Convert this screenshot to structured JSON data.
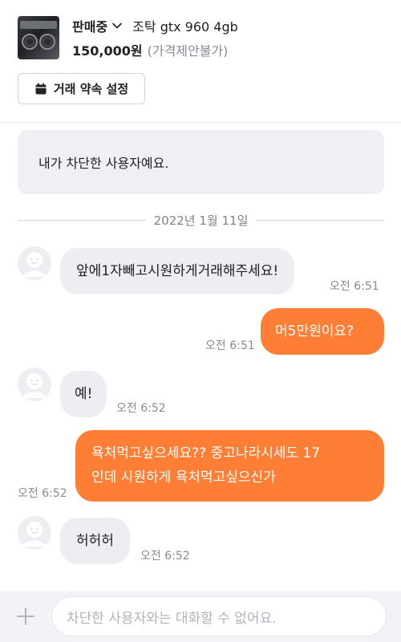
{
  "header": {
    "thumbnail_icon": "graphics-card-photo",
    "status_label": "판매중",
    "status_chevron_icon": "chevron-down-icon",
    "product_title": "조탁 gtx 960 4gb",
    "price": "150,000원",
    "price_note": "(가격제안불가)",
    "appointment_button": {
      "icon": "calendar-icon",
      "label": "거래 약속 설정"
    }
  },
  "chat": {
    "notice": "내가 차단한 사용자예요.",
    "date": "2022년 1월 11일",
    "messages": [
      {
        "from": "them",
        "text": "앞에1자빼고시원하게거래해주세요!",
        "time": "오전 6:51"
      },
      {
        "from": "me",
        "text": "머5만원이요?",
        "time": "오전 6:51"
      },
      {
        "from": "them",
        "text": "예!",
        "time": "오전 6:52"
      },
      {
        "from": "me",
        "lines": [
          "욕처먹고싶으세요?? 중고나라시세도 17",
          "인데 시원하게 욕처먹고싶으신가"
        ],
        "time": "오전 6:52"
      },
      {
        "from": "them",
        "text": "허허허",
        "time": "오전 6:52"
      }
    ]
  },
  "input_bar": {
    "add_icon": "plus-icon",
    "placeholder": "차단한 사용자와는 대화할 수 없어요."
  },
  "colors": {
    "accent": "#ff7e36",
    "bubble_incoming": "#eceef1",
    "muted_text": "#868b94"
  }
}
